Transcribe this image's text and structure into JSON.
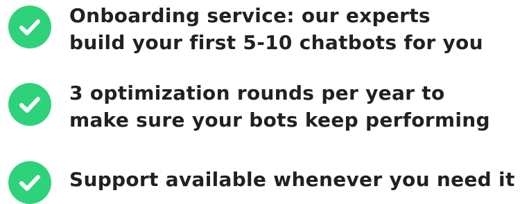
{
  "colors": {
    "accent": "#2ed27a",
    "text": "#1f2122"
  },
  "features": [
    {
      "icon": "check-icon",
      "lines": [
        "Onboarding service: our experts",
        "build your first 5-10 chatbots for you"
      ]
    },
    {
      "icon": "check-icon",
      "lines": [
        "3 optimization rounds per year to",
        "make sure your bots keep performing"
      ]
    },
    {
      "icon": "check-icon",
      "lines": [
        "Support available whenever you need it"
      ]
    }
  ]
}
